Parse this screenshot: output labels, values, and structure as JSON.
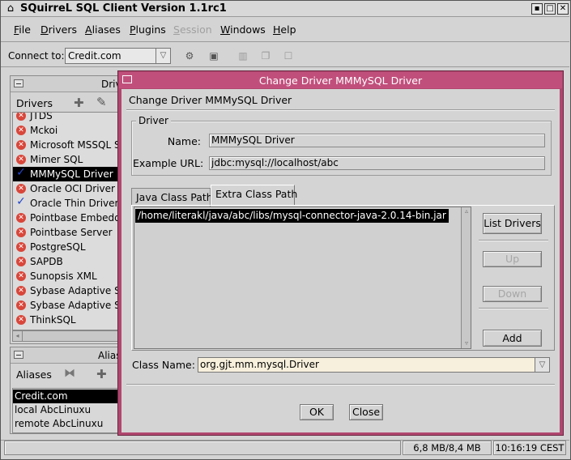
{
  "window": {
    "title": "SQuirreL SQL Client Version 1.1rc1",
    "icon": "squirrel-icon"
  },
  "menubar": {
    "items": [
      "File",
      "Drivers",
      "Aliases",
      "Plugins",
      "Session",
      "Windows",
      "Help"
    ],
    "mnemonics": [
      "F",
      "D",
      "A",
      "P",
      "S",
      "W",
      "H"
    ],
    "disabled": [
      "Session"
    ]
  },
  "toolbar": {
    "connect_label": "Connect to:",
    "connect_value": "Credit.com"
  },
  "drivers_frame": {
    "title": "Drivers",
    "toolbar_label": "Drivers",
    "items": [
      {
        "name": "JTDS",
        "status": "error"
      },
      {
        "name": "Mckoi",
        "status": "error"
      },
      {
        "name": "Microsoft MSSQL Server",
        "status": "error"
      },
      {
        "name": "Mimer SQL",
        "status": "error"
      },
      {
        "name": "MMMySQL Driver",
        "status": "ok",
        "selected": true
      },
      {
        "name": "Oracle OCI Driver",
        "status": "error"
      },
      {
        "name": "Oracle Thin Driver",
        "status": "ok"
      },
      {
        "name": "Pointbase Embedded",
        "status": "error"
      },
      {
        "name": "Pointbase Server",
        "status": "error"
      },
      {
        "name": "PostgreSQL",
        "status": "error"
      },
      {
        "name": "SAPDB",
        "status": "error"
      },
      {
        "name": "Sunopsis XML",
        "status": "error"
      },
      {
        "name": "Sybase Adaptive Server",
        "status": "error"
      },
      {
        "name": "Sybase Adaptive Server",
        "status": "error"
      },
      {
        "name": "ThinkSQL",
        "status": "error"
      }
    ]
  },
  "aliases_frame": {
    "title": "Aliases",
    "toolbar_label": "Aliases",
    "items": [
      {
        "name": "Credit.com",
        "selected": true
      },
      {
        "name": "local AbcLinuxu"
      },
      {
        "name": "remote AbcLinuxu"
      }
    ]
  },
  "dialog": {
    "title": "Change Driver MMMySQL Driver",
    "header": "Change Driver MMMySQL Driver",
    "driver_group": {
      "legend": "Driver",
      "name_label": "Name:",
      "name_value": "MMMySQL Driver",
      "url_label": "Example URL:",
      "url_value": "jdbc:mysql://localhost/abc"
    },
    "tabs": [
      {
        "label": "Java Class Path",
        "active": false
      },
      {
        "label": "Extra Class Path",
        "active": true
      }
    ],
    "class_path_entries": [
      "/home/literakl/java/abc/libs/mysql-connector-java-2.0.14-bin.jar"
    ],
    "buttons": {
      "list_drivers": "List Drivers",
      "up": "Up",
      "down": "Down",
      "add": "Add",
      "ok": "OK",
      "close": "Close"
    },
    "class_name_label": "Class Name:",
    "class_name_value": "org.gjt.mm.mysql.Driver"
  },
  "statusbar": {
    "memory": "6,8 MB/8,4 MB",
    "time": "10:16:19 CEST"
  },
  "colors": {
    "dialog_frame": "#b0476e",
    "dialog_titlebar": "#c14f7c",
    "error_icon": "#d9463a",
    "ok_check": "#2446c8",
    "selection": "#000000"
  }
}
